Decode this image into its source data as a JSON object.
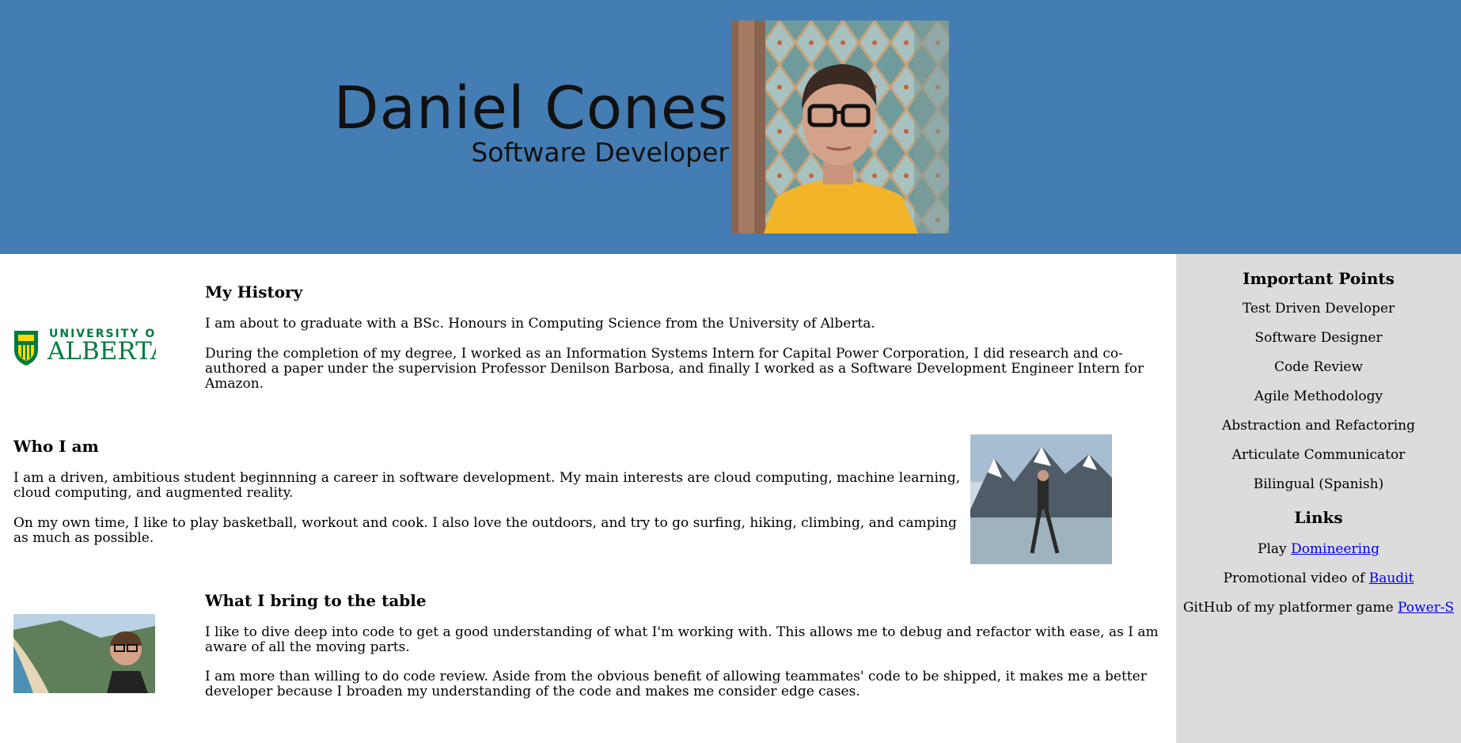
{
  "header": {
    "name": "Daniel Cones",
    "title": "Software Developer"
  },
  "sections": {
    "history": {
      "title": "My History",
      "p1": "I am about to graduate with a BSc. Honours in Computing Science from the University of Alberta.",
      "p2": "During the completion of my degree, I worked as an Information Systems Intern for Capital Power Corporation, I did research and co-authored a paper under the supervision Professor Denilson Barbosa, and finally I worked as a Software Development Engineer Intern for Amazon."
    },
    "who": {
      "title": "Who I am",
      "p1": "I am a driven, ambitious student beginnning a career in software development. My main interests are cloud computing, machine learning, cloud computing, and augmented reality.",
      "p2": "On my own time, I like to play basketball, workout and cook. I also love the outdoors, and try to go surfing, hiking, climbing, and camping as much as possible."
    },
    "bring": {
      "title": "What I bring to the table",
      "p1": "I like to dive deep into code to get a good understanding of what I'm working with. This allows me to debug and refactor with ease, as I am aware of all the moving parts.",
      "p2": "I am more than willing to do code review. Aside from the obvious benefit of allowing teammates' code to be shipped, it makes me a better developer because I broaden my understanding of the code and makes me consider edge cases."
    }
  },
  "logo": {
    "line1": "UNIVERSITY OF",
    "line2": "ALBERTA"
  },
  "sidebar": {
    "points_title": "Important Points",
    "points": [
      "Test Driven Developer",
      "Software Designer",
      "Code Review",
      "Agile Methodology",
      "Abstraction and Refactoring",
      "Articulate Communicator",
      "Bilingual (Spanish)"
    ],
    "links_title": "Links",
    "links": [
      {
        "prefix": "Play",
        "link_text": "Domineering"
      },
      {
        "prefix": "Promotional video of",
        "link_text": "Baudit"
      },
      {
        "prefix": "GitHub of my platformer game",
        "link_text": "Power-S"
      }
    ]
  },
  "colors": {
    "header_bg": "#447db3",
    "sidebar_bg": "#dcdcdc",
    "ualberta_green": "#007c41",
    "ualberta_gold": "#ffdb05",
    "link": "#0000ee"
  }
}
